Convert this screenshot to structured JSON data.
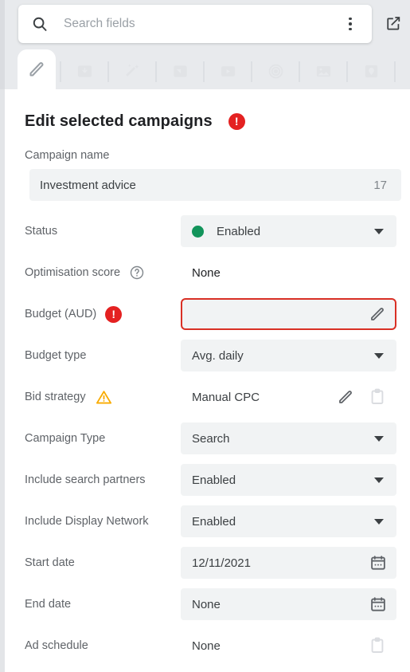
{
  "search": {
    "placeholder": "Search fields",
    "value": "",
    "icon": "search-icon",
    "overflow_icon": "more-vert-icon",
    "open_new_icon": "open-in-new-icon"
  },
  "tabs": [
    {
      "icon": "pencil-icon",
      "name": "tab-edit",
      "active": true,
      "disabled": false
    },
    {
      "icon": "download-icon",
      "name": "tab-download",
      "active": false,
      "disabled": true
    },
    {
      "icon": "magic-wand-icon",
      "name": "tab-recommend",
      "active": false,
      "disabled": true
    },
    {
      "icon": "tag-icon",
      "name": "tab-label",
      "active": false,
      "disabled": true
    },
    {
      "icon": "video-icon",
      "name": "tab-video",
      "active": false,
      "disabled": true
    },
    {
      "icon": "target-icon",
      "name": "tab-audience",
      "active": false,
      "disabled": true
    },
    {
      "icon": "image-icon",
      "name": "tab-image",
      "active": false,
      "disabled": true
    },
    {
      "icon": "location-pin-icon",
      "name": "tab-location",
      "active": false,
      "disabled": true
    },
    {
      "icon": "link-icon",
      "name": "tab-link",
      "active": false,
      "disabled": true
    },
    {
      "icon": "tag-outline-icon",
      "name": "tab-tag",
      "active": false,
      "disabled": true
    }
  ],
  "header": {
    "title": "Edit selected campaigns",
    "error_badge": "!",
    "error_color": "#e42121"
  },
  "campaign_name": {
    "label": "Campaign name",
    "value": "Investment advice",
    "char_count": "17"
  },
  "fields": {
    "status": {
      "label": "Status",
      "value": "Enabled",
      "dot_color": "#12945b"
    },
    "optimisation_score": {
      "label": "Optimisation score",
      "value": "None"
    },
    "budget": {
      "label": "Budget (AUD)",
      "value": "",
      "error_badge": "!",
      "border_color": "#d93025"
    },
    "budget_type": {
      "label": "Budget type",
      "value": "Avg. daily"
    },
    "bid_strategy": {
      "label": "Bid strategy",
      "value": "Manual CPC",
      "warn_color": "#f9ab00"
    },
    "campaign_type": {
      "label": "Campaign Type",
      "value": "Search"
    },
    "include_search_partners": {
      "label": "Include search partners",
      "value": "Enabled"
    },
    "include_display_network": {
      "label": "Include Display Network",
      "value": "Enabled"
    },
    "start_date": {
      "label": "Start date",
      "value": "12/11/2021"
    },
    "end_date": {
      "label": "End date",
      "value": "None"
    },
    "ad_schedule": {
      "label": "Ad schedule",
      "value": "None"
    }
  }
}
